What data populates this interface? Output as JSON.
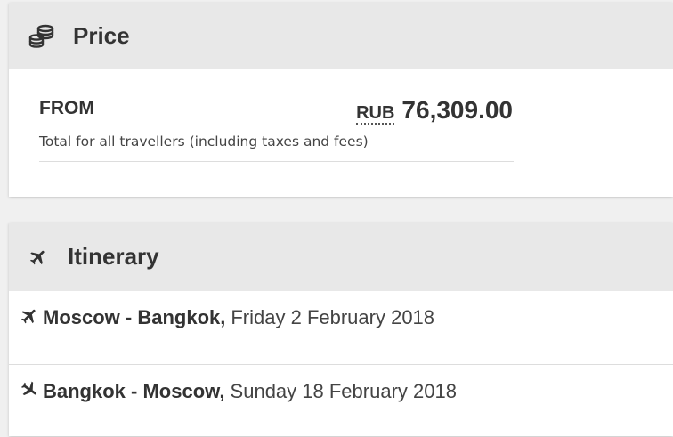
{
  "price": {
    "title": "Price",
    "icon": "coins-icon",
    "from_label": "FROM",
    "currency": "RUB",
    "amount": "76,309.00",
    "note": "Total for all travellers (including taxes and fees)"
  },
  "itinerary": {
    "title": "Itinerary",
    "icon": "plane-icon",
    "flights": [
      {
        "icon": "plane-depart-icon",
        "route": "Moscow - Bangkok,",
        "date": "Friday 2 February 2018"
      },
      {
        "icon": "plane-arrive-icon",
        "route": "Bangkok - Moscow,",
        "date": "Sunday 18 February 2018"
      }
    ]
  }
}
